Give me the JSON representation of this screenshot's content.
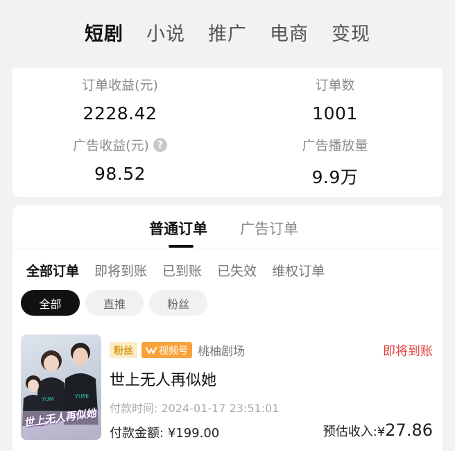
{
  "top_tabs": [
    "短剧",
    "小说",
    "推广",
    "电商",
    "变现"
  ],
  "stats": {
    "order_income_label": "订单收益(元)",
    "order_income_value": "2228.42",
    "order_count_label": "订单数",
    "order_count_value": "1001",
    "ad_income_label": "广告收益(元)",
    "ad_income_value": "98.52",
    "ad_plays_label": "广告播放量",
    "ad_plays_value": "9.9万",
    "help_icon": "?"
  },
  "order_tabs": [
    "普通订单",
    "广告订单"
  ],
  "status_filters": [
    "全部订单",
    "即将到账",
    "已到账",
    "已失效",
    "维权订单"
  ],
  "chips": [
    "全部",
    "直推",
    "粉丝"
  ],
  "order": {
    "badge_fans": "粉丝",
    "badge_channel_icon": "channels-icon",
    "badge_channel": "视频号",
    "studio": "桃柚剧场",
    "status": "即将到账",
    "title": "世上无人再似她",
    "pay_time_label": "付款时间:",
    "pay_time": "2024-01-17 23:51:01",
    "pay_amount_label": "付款金额:",
    "pay_amount": "¥199.00",
    "income_label": "预估收入:",
    "income_currency": "¥",
    "income_value": "27.86",
    "poster_text": "世上无人再似她"
  },
  "colors": {
    "accent_red": "#e0423b",
    "badge_orange": "#f9a23a",
    "badge_fans_bg": "#fdebc4",
    "page_bg": "#f2f2f4"
  }
}
